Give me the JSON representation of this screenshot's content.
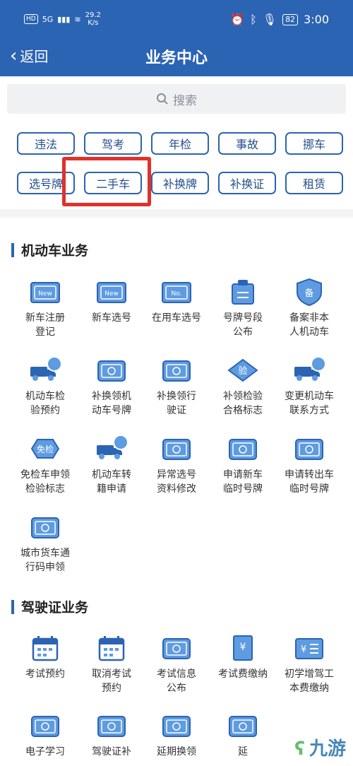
{
  "status_bar": {
    "hd": "HD",
    "net": "5G",
    "speed_value": "29.2",
    "speed_unit": "K/s",
    "battery": "82",
    "time": "3:00"
  },
  "header": {
    "back_label": "返回",
    "title": "业务中心"
  },
  "search": {
    "placeholder": "搜索"
  },
  "tags": [
    "违法",
    "驾考",
    "年检",
    "事故",
    "挪车",
    "选号牌",
    "二手车",
    "补换牌",
    "补换证",
    "租赁"
  ],
  "section_vehicle": {
    "title": "机动车业务",
    "items": [
      {
        "line1": "新车注册",
        "line2": "登记",
        "icon": "new-car-icon"
      },
      {
        "line1": "新车选号",
        "line2": "",
        "icon": "new-plate-icon"
      },
      {
        "line1": "在用车选号",
        "line2": "",
        "icon": "number-plate-icon"
      },
      {
        "line1": "号牌号段",
        "line2": "公布",
        "icon": "plate-segment-icon"
      },
      {
        "line1": "备案非本",
        "line2": "人机动车",
        "icon": "filing-shield-icon"
      },
      {
        "line1": "机动车检",
        "line2": "验预约",
        "icon": "inspection-truck-icon"
      },
      {
        "line1": "补换领机",
        "line2": "动车号牌",
        "icon": "plate-exchange-icon"
      },
      {
        "line1": "补换领行",
        "line2": "驶证",
        "icon": "license-exchange-icon"
      },
      {
        "line1": "补领检验",
        "line2": "合格标志",
        "icon": "inspection-mark-icon"
      },
      {
        "line1": "变更机动车",
        "line2": "联系方式",
        "icon": "contact-truck-icon"
      },
      {
        "line1": "免检车申领",
        "line2": "检验标志",
        "icon": "exempt-badge-icon"
      },
      {
        "line1": "机动车转",
        "line2": "籍申请",
        "icon": "transfer-truck-icon"
      },
      {
        "line1": "异常选号",
        "line2": "资料修改",
        "icon": "edit-card-icon"
      },
      {
        "line1": "申请新车",
        "line2": "临时号牌",
        "icon": "temp-plate-icon"
      },
      {
        "line1": "申请转出车",
        "line2": "临时号牌",
        "icon": "radio-plate-icon"
      },
      {
        "line1": "城市货车通",
        "line2": "行码申领",
        "icon": "city-truck-icon"
      }
    ]
  },
  "section_license": {
    "title": "驾驶证业务",
    "items": [
      {
        "line1": "考试预约",
        "line2": "",
        "icon": "calendar-icon"
      },
      {
        "line1": "取消考试",
        "line2": "预约",
        "icon": "calendar-cancel-icon"
      },
      {
        "line1": "考试信息",
        "line2": "公布",
        "icon": "exam-info-icon"
      },
      {
        "line1": "考试费缴纳",
        "line2": "",
        "icon": "fee-receipt-icon"
      },
      {
        "line1": "初学增驾工",
        "line2": "本费缴纳",
        "icon": "fee-card-icon"
      },
      {
        "line1": "电子学习",
        "line2": "",
        "icon": "e-learning-icon"
      },
      {
        "line1": "驾驶证补",
        "line2": "",
        "icon": "license-reissue-icon"
      },
      {
        "line1": "延期换领",
        "line2": "",
        "icon": "renewal-icon"
      },
      {
        "line1": "延",
        "line2": "",
        "icon": "partial-icon"
      }
    ]
  },
  "watermark": {
    "text": "九游"
  },
  "colors": {
    "primary": "#2c64b4",
    "highlight": "#e0312a"
  }
}
